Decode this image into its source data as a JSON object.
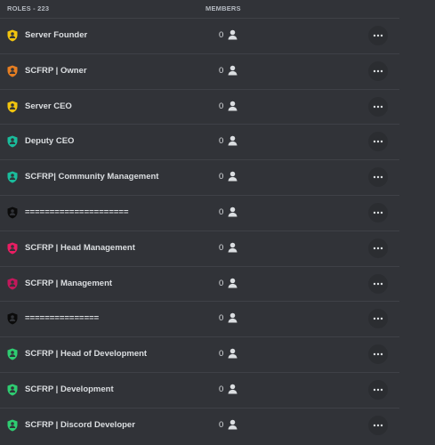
{
  "header": {
    "roles_label": "ROLES - 223",
    "members_label": "MEMBERS"
  },
  "roles": [
    {
      "name": "Server Founder",
      "members": "0",
      "color": "#f1c40f"
    },
    {
      "name": "SCFRP | Owner",
      "members": "0",
      "color": "#e67e22"
    },
    {
      "name": "Server CEO",
      "members": "0",
      "color": "#f1c40f"
    },
    {
      "name": "Deputy CEO",
      "members": "0",
      "color": "#1abc9c"
    },
    {
      "name": "SCFRP| Community Management",
      "members": "0",
      "color": "#1abc9c"
    },
    {
      "name": "=====================",
      "members": "0",
      "color": "#0b0b0b"
    },
    {
      "name": "SCFRP | Head Management",
      "members": "0",
      "color": "#e91e63"
    },
    {
      "name": "SCFRP | Management",
      "members": "0",
      "color": "#c2185b"
    },
    {
      "name": "===============",
      "members": "0",
      "color": "#0b0b0b"
    },
    {
      "name": "SCFRP | Head of Development",
      "members": "0",
      "color": "#2ecc71"
    },
    {
      "name": "SCFRP | Development",
      "members": "0",
      "color": "#2ecc71"
    },
    {
      "name": "SCFRP | Discord Developer",
      "members": "0",
      "color": "#2ecc71"
    }
  ],
  "icons": {
    "role": "shield-icon",
    "members": "person-icon",
    "more": "more-options-icon"
  }
}
